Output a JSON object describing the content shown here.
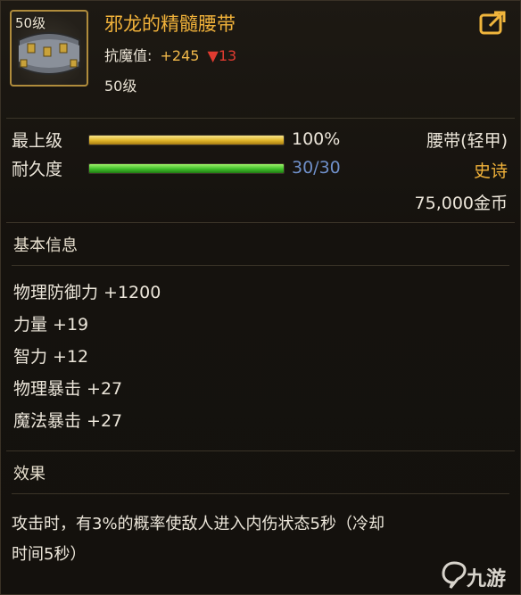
{
  "item": {
    "level_badge": "50级",
    "name": "邪龙的精髓腰带",
    "resist_label": "抗魔值:",
    "resist_value": "+245",
    "resist_drop": "▼13",
    "required_level": "50级"
  },
  "bars": {
    "upgrade": {
      "label": "最上级",
      "value_text": "100%",
      "fill": 1.0
    },
    "durability": {
      "label": "耐久度",
      "value_text": "30/30",
      "fill": 1.0
    }
  },
  "info": {
    "type": "腰带(轻甲)",
    "rarity": "史诗",
    "price": "75,000金币"
  },
  "basic": {
    "title": "基本信息",
    "attrs": [
      "物理防御力 +1200",
      "力量 +19",
      "智力 +12",
      "物理暴击 +27",
      "魔法暴击 +27"
    ]
  },
  "effect": {
    "title": "效果",
    "line1": "攻击时，有3%的概率使敌人进入内伤状态5秒（冷却",
    "line2": "时间5秒）"
  },
  "watermark": {
    "text": "九游"
  },
  "icons": {
    "share": "share-icon",
    "belt": "belt-icon",
    "logo": "jiuyou-logo-icon"
  },
  "colors": {
    "name": "#f1b23a",
    "rarity": "#f1b23a",
    "durability_value": "#6f8fc9",
    "drop": "#e03b30"
  }
}
